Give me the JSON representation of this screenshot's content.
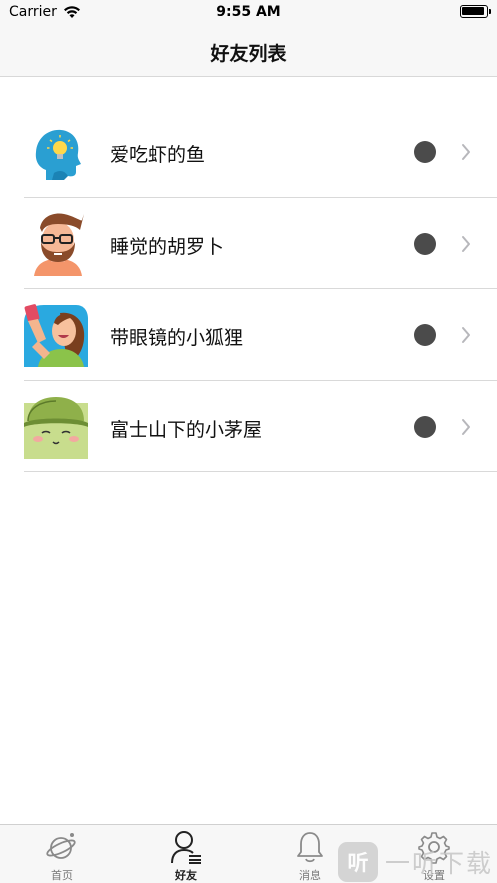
{
  "status_bar": {
    "carrier": "Carrier",
    "time": "9:55 AM",
    "battery_level": 0.95
  },
  "nav": {
    "title": "好友列表"
  },
  "friends": [
    {
      "name": "爱吃虾的鱼",
      "avatar": "idea-head-avatar",
      "status_color": "#4b4b4b"
    },
    {
      "name": "睡觉的胡罗卜",
      "avatar": "bearded-man-avatar",
      "status_color": "#4b4b4b"
    },
    {
      "name": "带眼镜的小狐狸",
      "avatar": "selfie-woman-avatar",
      "status_color": "#4b4b4b"
    },
    {
      "name": "富士山下的小茅屋",
      "avatar": "green-cap-character-avatar",
      "status_color": "#4b4b4b"
    }
  ],
  "tabs": [
    {
      "label": "首页",
      "icon": "planet-icon",
      "active": false
    },
    {
      "label": "好友",
      "icon": "user-list-icon",
      "active": true
    },
    {
      "label": "消息",
      "icon": "bell-icon",
      "active": false
    },
    {
      "label": "设置",
      "icon": "gear-icon",
      "active": false
    }
  ],
  "watermark": {
    "logo_text": "听",
    "text": "一听下载"
  },
  "colors": {
    "bar_background": "#f7f7f7",
    "status_dot": "#4b4b4b",
    "separator": "#d9d9d9"
  }
}
